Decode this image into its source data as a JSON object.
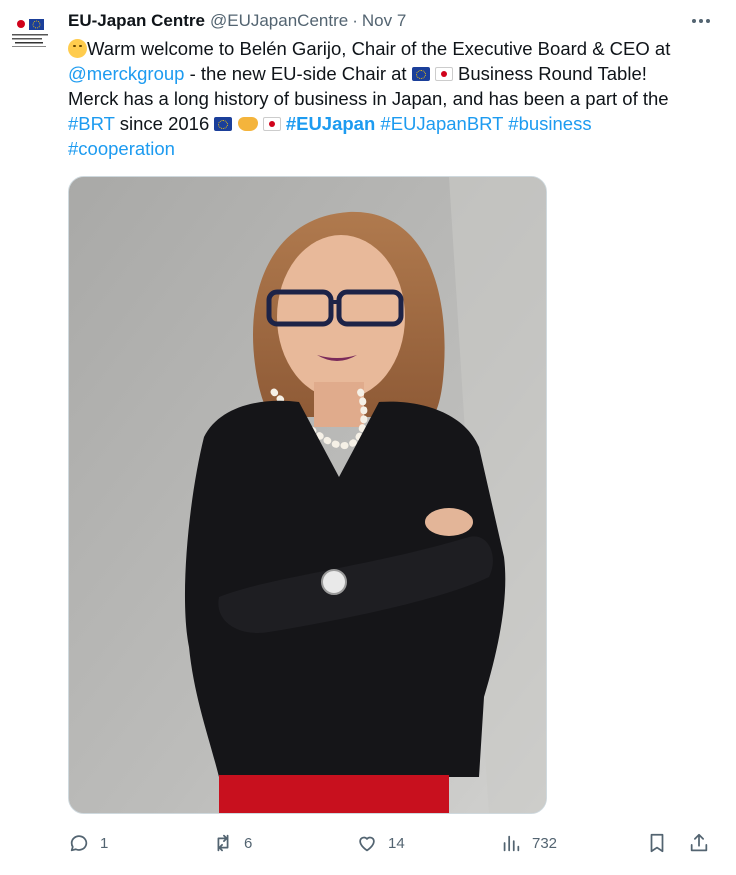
{
  "tweet": {
    "author_name": "EU-Japan Centre",
    "handle": "@EUJapanCentre",
    "separator": "·",
    "date": "Nov 7",
    "avatar_text": "EU-Japan Centre",
    "text": {
      "l1_a": "Warm welcome to Belén Garijo, Chair of the Executive Board & CEO at",
      "l2_mention": "@merckgroup",
      "l2_a": " - the new EU-side Chair at ",
      "l2_b": " Business Round Table!",
      "l3": "Merck has a long history of business in Japan, and has been a part of the",
      "l4_tag1": "#BRT",
      "l4_a": " since 2016 ",
      "l4_tag2": "#EUJapan",
      "l4_tag3": "#EUJapanBRT",
      "l4_tag4": "#business",
      "l5_tag": "#cooperation"
    },
    "image_alt": "Portrait photo of Belén Garijo"
  },
  "actions": {
    "replies": "1",
    "reposts": "6",
    "likes": "14",
    "views": "732"
  },
  "icons": [
    "more-icon",
    "reply-icon",
    "repost-icon",
    "like-icon",
    "views-icon",
    "bookmark-icon",
    "share-icon"
  ],
  "colors": {
    "link": "#1d9bf0",
    "muted": "#536471",
    "text": "#0f1419"
  }
}
